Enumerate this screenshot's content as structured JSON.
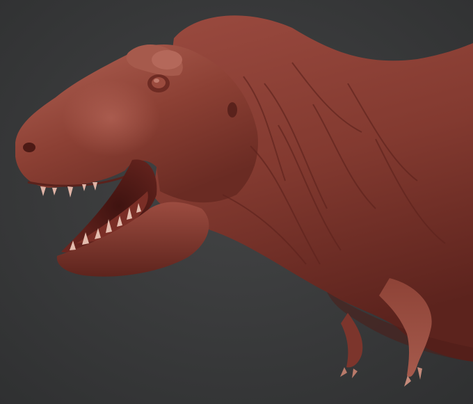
{
  "scene": {
    "subject": "t-rex-sculpt",
    "background_color": "#3b3c3d",
    "skin_color": "#8a3d33",
    "skin_highlight": "#b86a5c",
    "skin_shadow": "#4f1d18",
    "mouth_interior": "#5a1c17",
    "teeth_color": "#e0b4a6"
  }
}
